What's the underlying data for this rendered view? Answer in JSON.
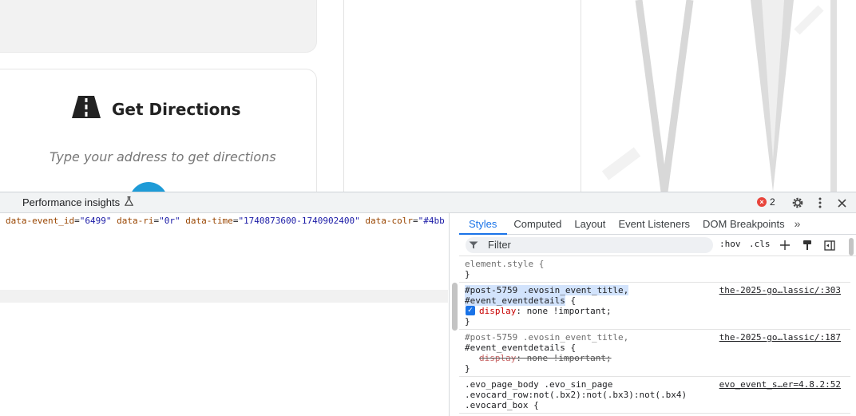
{
  "webpage": {
    "directions_title": "Get Directions",
    "directions_subtitle": "Type your address to get directions"
  },
  "devtools": {
    "drawer_tab": "Performance insights",
    "error_count": "2",
    "elements_line": [
      {
        "name": "data-event_id",
        "value": "\"6499\""
      },
      {
        "name": "data-ri",
        "value": "\"0r\""
      },
      {
        "name": "data-time",
        "value": "\"1740873600-1740902400\""
      },
      {
        "name": "data-colr",
        "value": "\"#4bb"
      }
    ],
    "tabs": [
      "Styles",
      "Computed",
      "Layout",
      "Event Listeners",
      "DOM Breakpoints"
    ],
    "filter_placeholder": "Filter",
    "hov_label": ":hov",
    "cls_label": ".cls",
    "rules": {
      "r0": {
        "selector": "element.style {",
        "close": "}"
      },
      "r1": {
        "sel1": "#post-5759 .evosin_event_title,",
        "sel2": "#event_eventdetails",
        "open": " {",
        "source": "the-2025-go…lassic/:303",
        "prop": "display",
        "value": ": none !important;",
        "close": "}"
      },
      "r2": {
        "sel1": "#post-5759 .evosin_event_title,",
        "sel2": "#event_eventdetails {",
        "source": "the-2025-go…lassic/:187",
        "prop": "display",
        "value": ": none !important;",
        "close": "}"
      },
      "r3": {
        "sel1": ".evo_page_body .evo_sin_page",
        "sel2": ".evocard_row:not(.bx2):not(.bx3):not(.bx4)",
        "sel3": ".evocard_box {",
        "source": "evo_event_s…er=4.8.2:52"
      }
    }
  }
}
